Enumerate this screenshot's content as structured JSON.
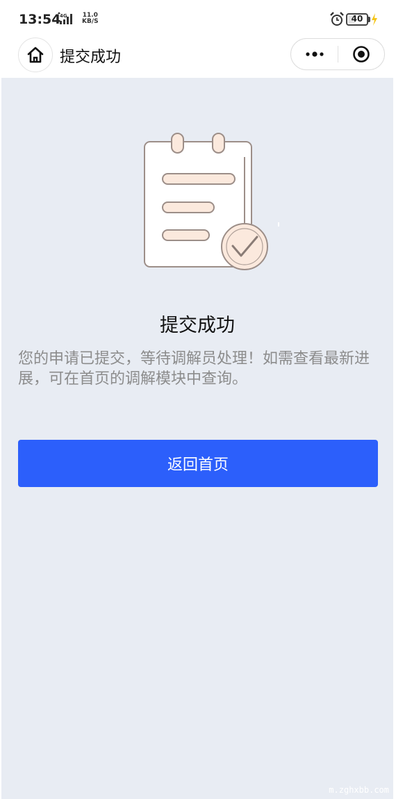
{
  "status_bar": {
    "time": "13:54",
    "network_label": "4G",
    "speed_value": "11.0",
    "speed_unit": "KB/S",
    "battery_level": "40",
    "icons": [
      "network-signal-icon",
      "alarm-icon",
      "battery-icon",
      "charging-bolt-icon"
    ]
  },
  "nav": {
    "title": "提交成功",
    "icons": [
      "home-icon",
      "more-dots-icon",
      "close-target-icon"
    ]
  },
  "result": {
    "title": "提交成功",
    "description": "您的申请已提交，等待调解员处理！如需查看最新进展，可在首页的调解模块中查询。",
    "illustration": "clipboard-check-illustration"
  },
  "actions": {
    "back_home_label": "返回首页"
  },
  "watermark": "m.zghxbb.com",
  "colors": {
    "primary_button": "#2c5ffb",
    "content_background": "#e8ecf3",
    "description_text": "#8c8c8c",
    "illustration_accent": "#f8e4d6"
  }
}
